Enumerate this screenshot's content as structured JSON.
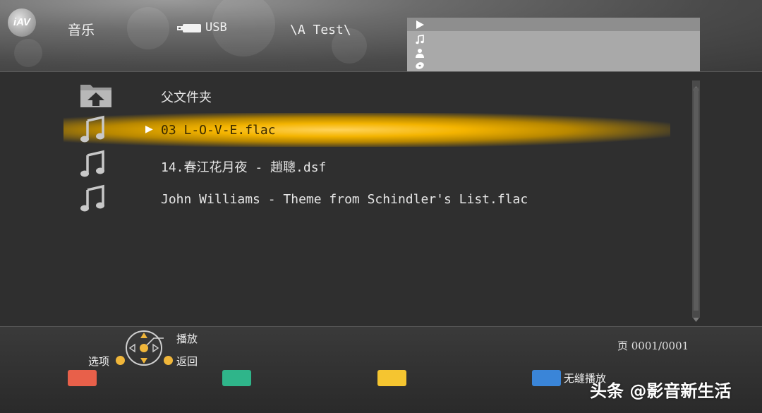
{
  "header": {
    "logo_text": "iAV",
    "title": "音乐",
    "source_label": "USB",
    "path": "\\A Test\\"
  },
  "filters": [
    {
      "icon": "play-icon",
      "active": true
    },
    {
      "icon": "music-note-icon",
      "active": false
    },
    {
      "icon": "person-icon",
      "active": false
    },
    {
      "icon": "disc-icon",
      "active": false
    }
  ],
  "list": {
    "items": [
      {
        "icon": "parent-folder-icon",
        "label": "父文件夹"
      },
      {
        "icon": "music-note-icon",
        "label": "03 L-O-V-E.flac",
        "selected": true
      },
      {
        "icon": "music-note-icon",
        "label": "14.春江花月夜 - 趙聰.dsf"
      },
      {
        "icon": "music-note-icon",
        "label": "John Williams - Theme from Schindler's List.flac"
      }
    ],
    "selected_marker": "▶"
  },
  "footer": {
    "play_label": "播放",
    "options_label": "选项",
    "back_label": "返回",
    "page_label": "页 0001/0001",
    "keys": [
      {
        "color": "#e8604a",
        "label": ""
      },
      {
        "color": "#2fb58a",
        "label": ""
      },
      {
        "color": "#f5c530",
        "label": ""
      },
      {
        "color": "#3a85d8",
        "label": "无缝播放"
      }
    ]
  },
  "watermark": "头条 @影音新生活",
  "colors": {
    "selection": "#f4b400",
    "background": "#2f2f2f"
  }
}
